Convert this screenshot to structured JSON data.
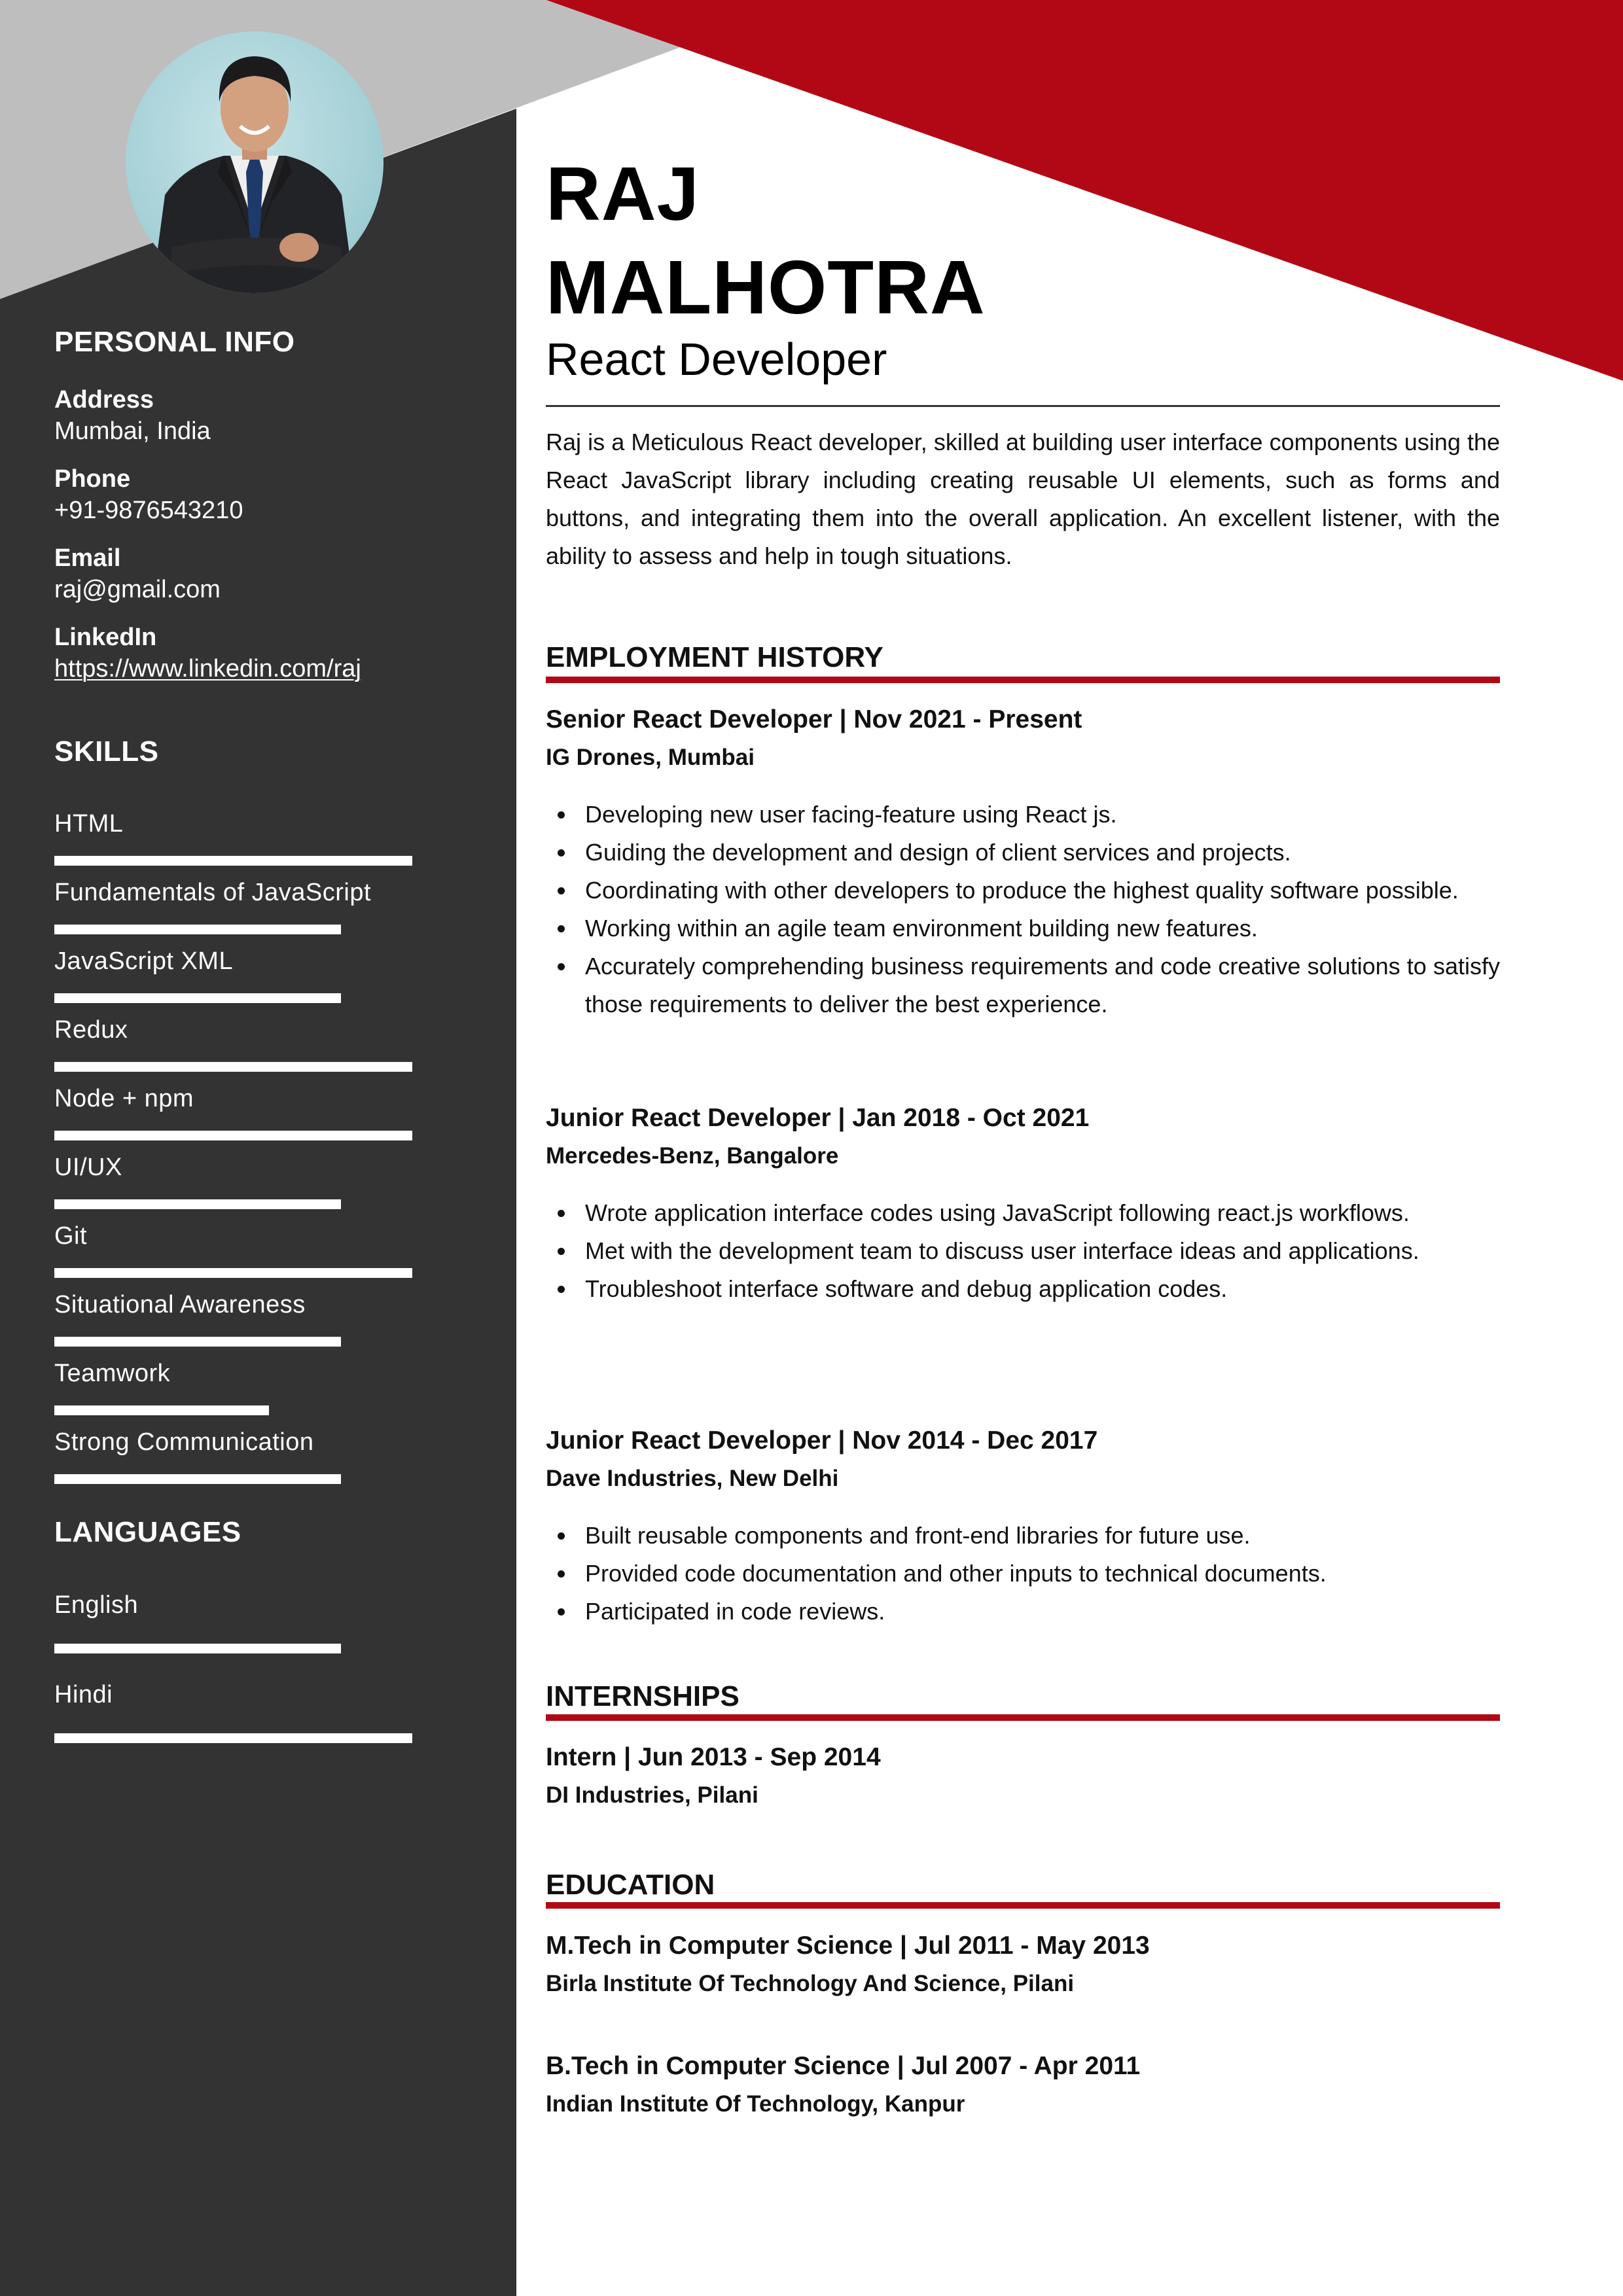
{
  "colors": {
    "accent_red": "#b20815",
    "sidebar_dark": "#333333",
    "header_gray": "#bebebe",
    "text": "#111111"
  },
  "header": {
    "first_name": "RAJ",
    "last_name": "MALHOTRA",
    "job_title": "React Developer",
    "photo_icon": "profile-photo"
  },
  "summary": "Raj is a Meticulous React developer, skilled at building user interface components using the React JavaScript library including creating reusable UI elements, such as forms and buttons, and integrating them into the overall application. An excellent listener, with the ability to assess and help in tough situations.",
  "sidebar": {
    "personal_info": {
      "heading": "PERSONAL INFO",
      "items": [
        {
          "label": "Address",
          "value": "Mumbai, India"
        },
        {
          "label": "Phone",
          "value": "+91-9876543210"
        },
        {
          "label": "Email",
          "value": "raj@gmail.com"
        },
        {
          "label": "LinkedIn",
          "value": "https://www.linkedin.com/raj"
        }
      ]
    },
    "skills": {
      "heading": "SKILLS",
      "items": [
        {
          "name": "HTML",
          "level_percent": 100
        },
        {
          "name": "Fundamentals of JavaScript",
          "level_percent": 80
        },
        {
          "name": "JavaScript XML",
          "level_percent": 80
        },
        {
          "name": "Redux",
          "level_percent": 100
        },
        {
          "name": "Node + npm",
          "level_percent": 100
        },
        {
          "name": "UI/UX",
          "level_percent": 80
        },
        {
          "name": "Git",
          "level_percent": 100
        },
        {
          "name": "Situational Awareness",
          "level_percent": 80
        },
        {
          "name": "Teamwork",
          "level_percent": 60
        },
        {
          "name": "Strong Communication",
          "level_percent": 80
        }
      ]
    },
    "languages": {
      "heading": "LANGUAGES",
      "items": [
        {
          "name": "English",
          "level_percent": 80
        },
        {
          "name": "Hindi",
          "level_percent": 100
        }
      ]
    }
  },
  "employment": {
    "heading": "EMPLOYMENT HISTORY",
    "jobs": [
      {
        "title": "Senior React Developer | Nov 2021 - Present",
        "company": "IG Drones, Mumbai",
        "bullets": [
          "Developing new user facing-feature using React js.",
          "Guiding the development and design of client services and projects.",
          "Coordinating with other developers to produce the highest quality software possible.",
          "Working within an agile team environment building new features.",
          "Accurately comprehending business requirements and code creative solutions to satisfy those requirements to deliver the best experience."
        ]
      },
      {
        "title": "Junior React Developer | Jan 2018 - Oct 2021",
        "company": "Mercedes-Benz, Bangalore",
        "bullets": [
          "Wrote application interface codes using JavaScript following react.js workflows.",
          "Met with the development team to discuss user interface ideas and applications.",
          "Troubleshoot interface software and debug application codes."
        ]
      },
      {
        "title": "Junior React Developer | Nov 2014 - Dec 2017",
        "company": "Dave Industries, New Delhi",
        "bullets": [
          "Built reusable components and front-end libraries for future use.",
          "Provided code documentation and other inputs to technical documents.",
          "Participated in code reviews."
        ]
      }
    ]
  },
  "internships": {
    "heading": "INTERNSHIPS",
    "items": [
      {
        "title": "Intern | Jun 2013 - Sep 2014",
        "company": "DI Industries, Pilani"
      }
    ]
  },
  "education": {
    "heading": "EDUCATION",
    "items": [
      {
        "title": "M.Tech in Computer Science | Jul 2011 - May 2013",
        "institution": "Birla Institute Of Technology And Science, Pilani"
      },
      {
        "title": "B.Tech in Computer Science | Jul 2007 - Apr 2011",
        "institution": "Indian Institute Of Technology, Kanpur"
      }
    ]
  }
}
